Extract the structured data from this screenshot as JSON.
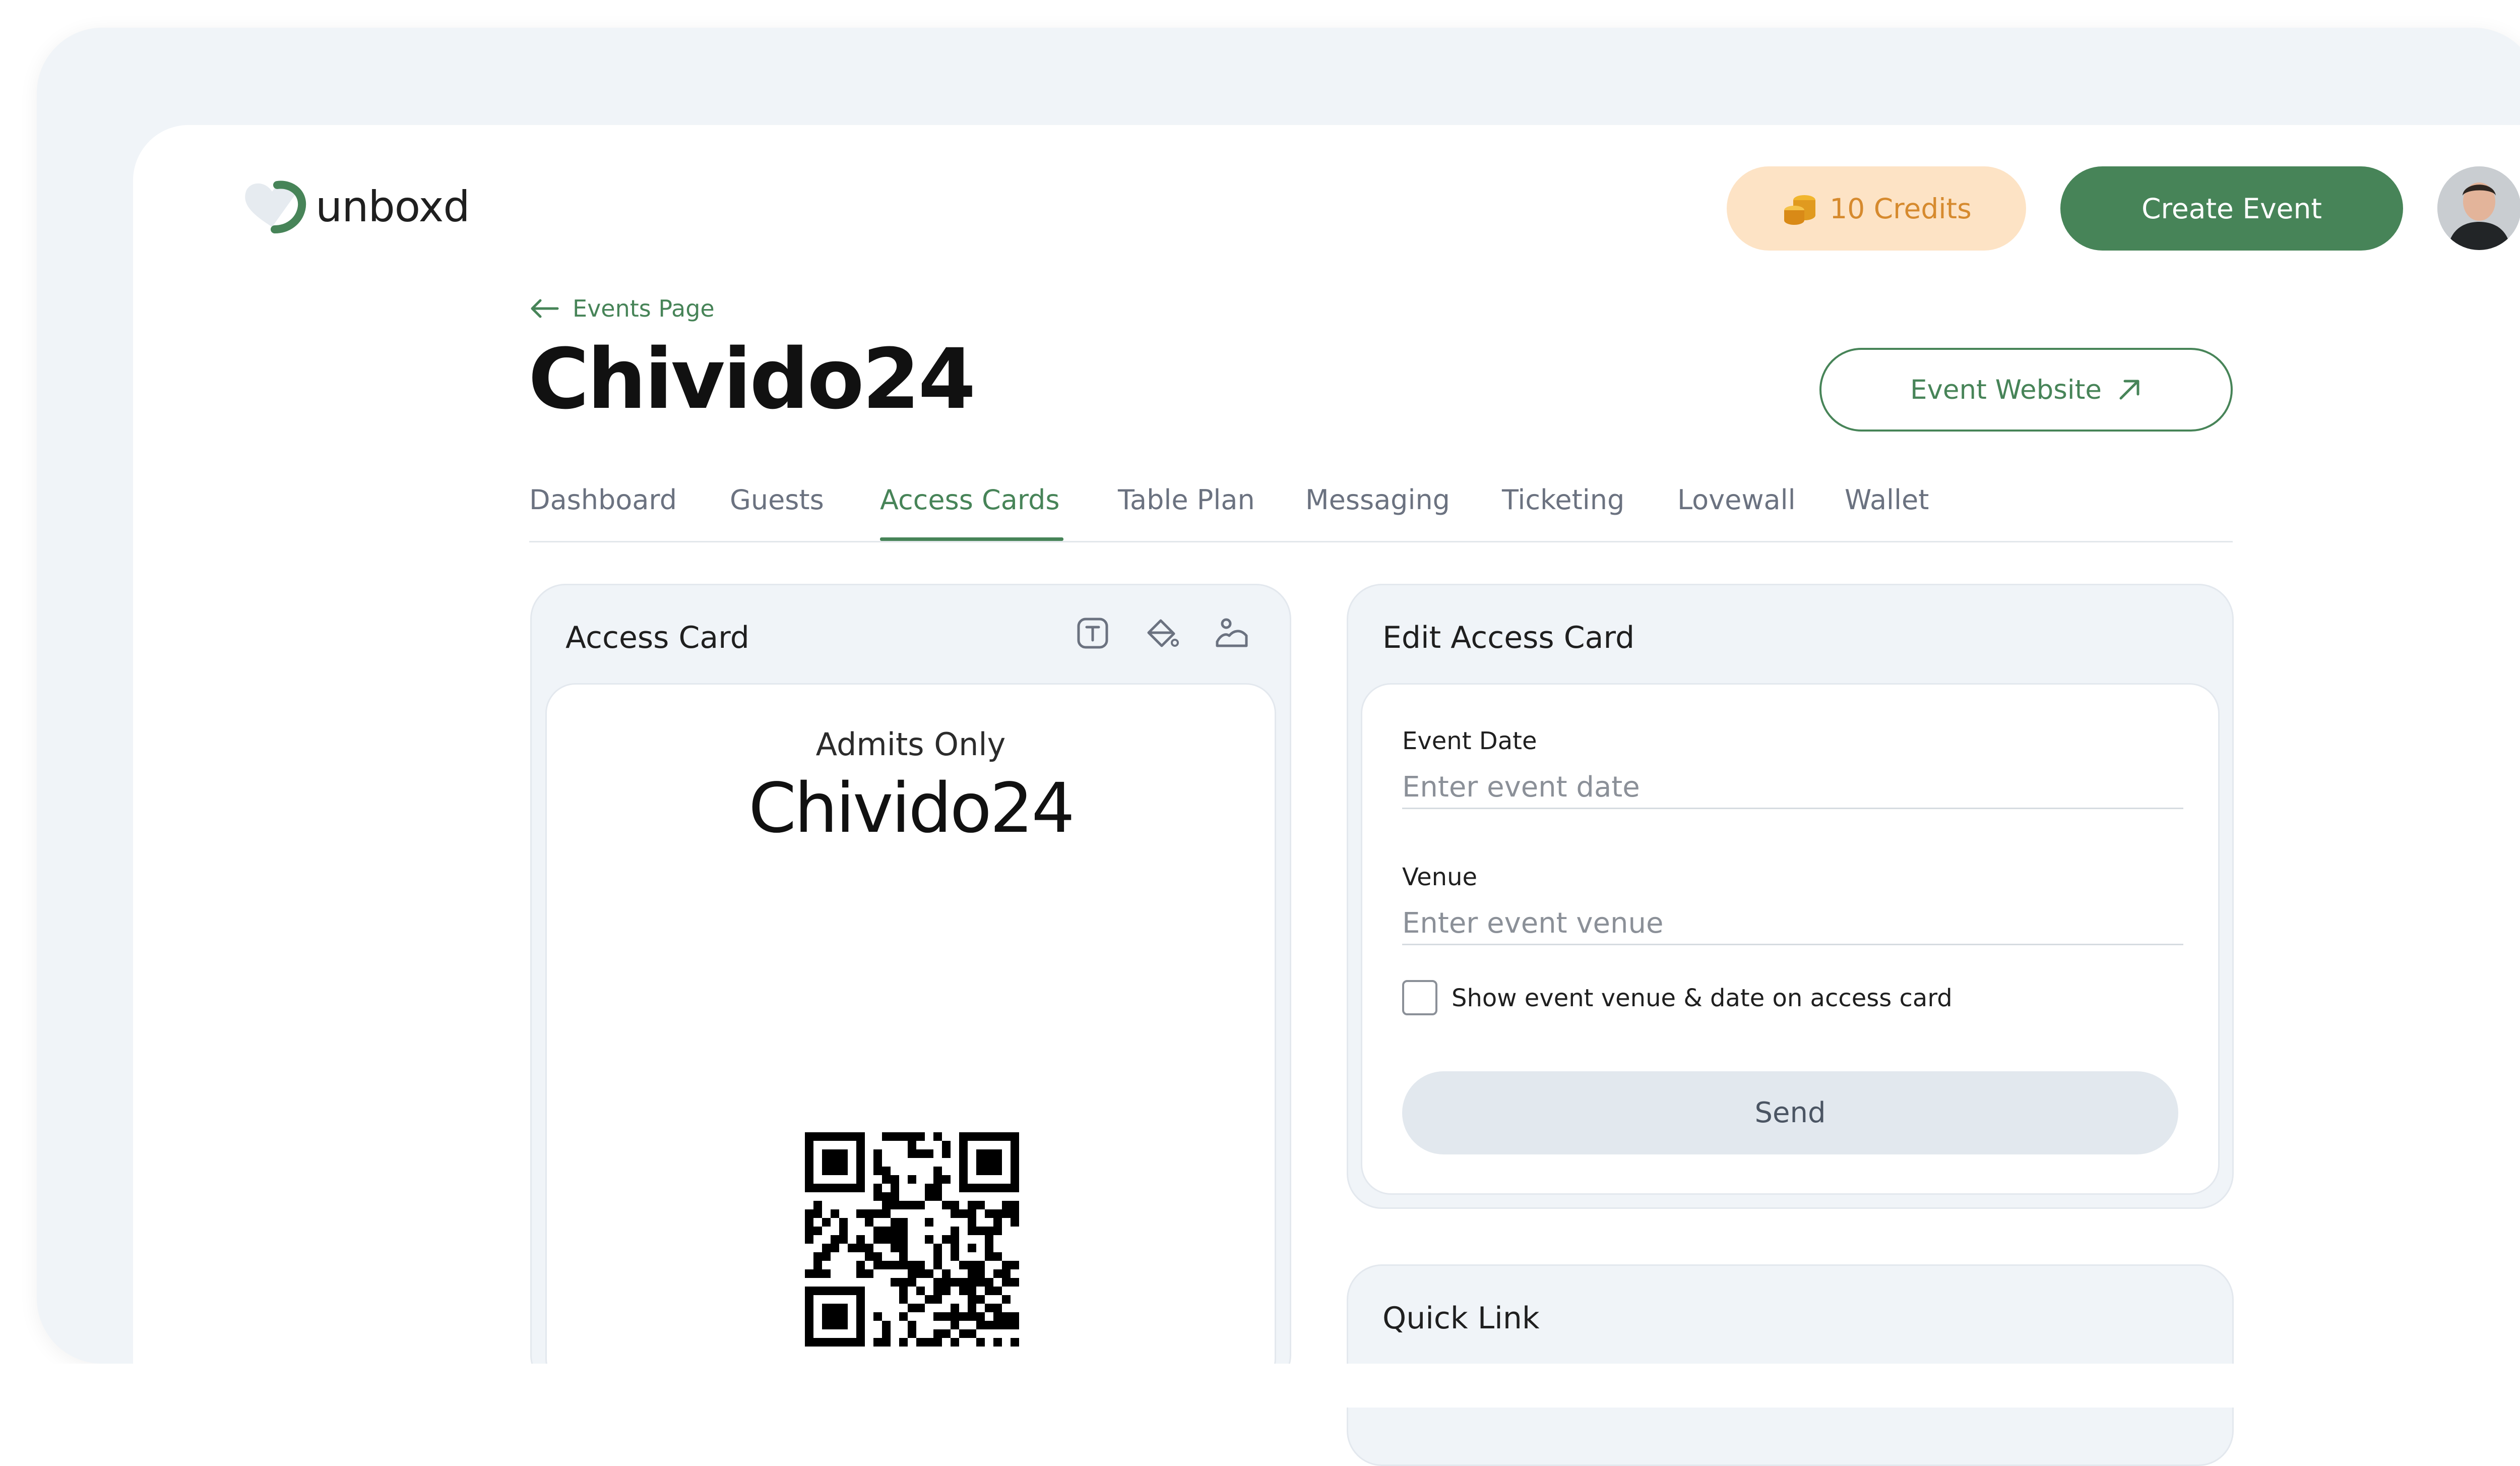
{
  "header": {
    "logo_text": "unboxd",
    "credits_label": "10 Credits",
    "create_event_label": "Create Event"
  },
  "breadcrumb": {
    "back_label": "Events Page"
  },
  "event": {
    "title": "Chivido24",
    "website_label": "Event Website"
  },
  "tabs": [
    {
      "label": "Dashboard",
      "active": false
    },
    {
      "label": "Guests",
      "active": false
    },
    {
      "label": "Access Cards",
      "active": true
    },
    {
      "label": "Table Plan",
      "active": false
    },
    {
      "label": "Messaging",
      "active": false
    },
    {
      "label": "Ticketing",
      "active": false
    },
    {
      "label": "Lovewall",
      "active": false
    },
    {
      "label": "Wallet",
      "active": false
    }
  ],
  "access_card": {
    "title": "Access Card",
    "tools": [
      "text-tool-icon",
      "paint-bucket-icon",
      "image-icon"
    ],
    "admits_label": "Admits Only",
    "event_name": "Chivido24"
  },
  "edit_card": {
    "title": "Edit Access Card",
    "event_date_label": "Event Date",
    "event_date_placeholder": "Enter event date",
    "venue_label": "Venue",
    "venue_placeholder": "Enter event venue",
    "checkbox_label": "Show event venue & date on access card",
    "checkbox_checked": false,
    "send_label": "Send"
  },
  "quick_link": {
    "title": "Quick Link"
  },
  "colors": {
    "brand_green": "#478458",
    "credits_bg": "#fde3c5",
    "credits_text": "#d68a2e",
    "panel_bg": "#f0f4f8"
  }
}
